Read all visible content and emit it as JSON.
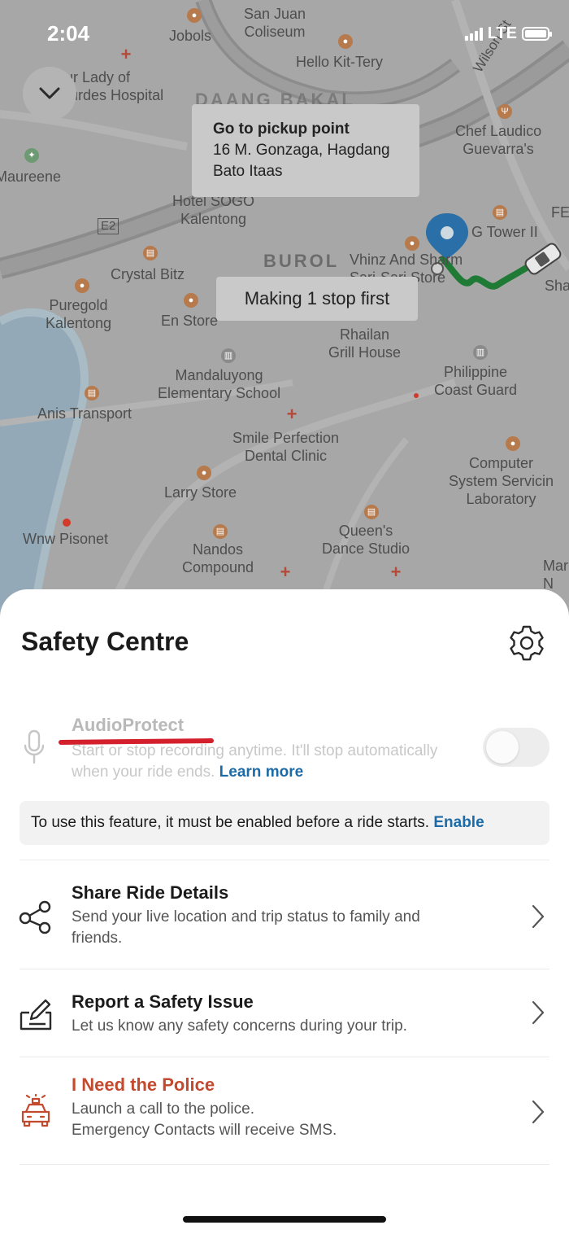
{
  "status_bar": {
    "time": "2:04",
    "network": "LTE",
    "signal_bars": 4,
    "battery_level": 1.0
  },
  "map": {
    "labels": [
      {
        "id": "sanjuan",
        "text": "San Juan\nColiseum"
      },
      {
        "id": "jobols",
        "text": "Jobols"
      },
      {
        "id": "hellokit",
        "text": "Hello Kit-Tery"
      },
      {
        "id": "wilson",
        "text": "Wilson St"
      },
      {
        "id": "ourlady",
        "text": "Our Lady of\nLourdes Hospital"
      },
      {
        "id": "daang",
        "text": "DAANG BAKAL"
      },
      {
        "id": "chef",
        "text": "Chef Laudico\nGuevarra's"
      },
      {
        "id": "maureene",
        "text": "Maureene"
      },
      {
        "id": "hotel",
        "text": "Hotel SOGO\nKalentong"
      },
      {
        "id": "e2",
        "text": "E2"
      },
      {
        "id": "tower",
        "text": "G Tower II"
      },
      {
        "id": "fe",
        "text": "FE"
      },
      {
        "id": "burol",
        "text": "BUROL"
      },
      {
        "id": "vhinz",
        "text": "Vhinz And Sharm\nSari-Sari Store"
      },
      {
        "id": "crystal",
        "text": "Crystal Bitz"
      },
      {
        "id": "sha",
        "text": "Sha"
      },
      {
        "id": "puregold",
        "text": "Puregold\nKalentong"
      },
      {
        "id": "enstore",
        "text": "En Store"
      },
      {
        "id": "rhailan",
        "text": "Rhailan\nGrill House"
      },
      {
        "id": "mandaluyong",
        "text": "Mandaluyong\nElementary School"
      },
      {
        "id": "philippine",
        "text": "Philippine\nCoast Guard"
      },
      {
        "id": "anis",
        "text": "Anis Transport"
      },
      {
        "id": "smile",
        "text": "Smile Perfection\nDental Clinic"
      },
      {
        "id": "computer",
        "text": "Computer\nSystem Servicin\nLaboratory"
      },
      {
        "id": "larry",
        "text": "Larry Store"
      },
      {
        "id": "wnw",
        "text": "Wnw Pisonet"
      },
      {
        "id": "nandos",
        "text": "Nandos\nCompound"
      },
      {
        "id": "queens",
        "text": "Queen's\nDance Studio"
      },
      {
        "id": "mar",
        "text": "Mar\nN"
      }
    ],
    "pickup_card": {
      "title": "Go to pickup point",
      "address": "16 M. Gonzaga, Hagdang Bato Itaas"
    },
    "stop_card": "Making 1 stop first",
    "route_color": "#1f7a35",
    "pin_color": "#2a6fa8"
  },
  "sheet": {
    "title": "Safety Centre",
    "audio_protect": {
      "title": "AudioProtect",
      "description": "Start or stop recording anytime. It'll stop automatically when your ride ends.",
      "link": "Learn more",
      "enabled": false
    },
    "notice": {
      "text": "To use this feature, it must be enabled before a ride starts.",
      "link": "Enable"
    },
    "options": [
      {
        "title": "Share Ride Details",
        "description": "Send your live location and trip status to family and friends.",
        "icon": "share-icon"
      },
      {
        "title": "Report a Safety Issue",
        "description": "Let us know any safety concerns during your trip.",
        "icon": "report-edit-icon"
      },
      {
        "title": "I Need the Police",
        "description": "Launch a call to the police.\nEmergency Contacts will receive SMS.",
        "icon": "police-car-icon",
        "color": "#c44a2f"
      }
    ]
  },
  "colors": {
    "link": "#1c6ba7",
    "highlight_underline": "#d4202c",
    "police": "#c44a2f"
  }
}
